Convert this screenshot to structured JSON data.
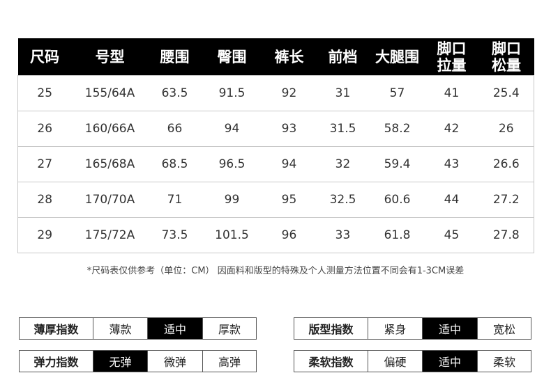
{
  "size_table": {
    "headers": [
      "尺码",
      "号型",
      "腰围",
      "臀围",
      "裤长",
      "前档",
      "大腿围",
      "脚口\n拉量",
      "脚口\n松量"
    ],
    "rows": [
      [
        "25",
        "155/64A",
        "63.5",
        "91.5",
        "92",
        "31",
        "57",
        "41",
        "25.4"
      ],
      [
        "26",
        "160/66A",
        "66",
        "94",
        "93",
        "31.5",
        "58.2",
        "42",
        "26"
      ],
      [
        "27",
        "165/68A",
        "68.5",
        "96.5",
        "94",
        "32",
        "59.4",
        "43",
        "26.6"
      ],
      [
        "28",
        "170/70A",
        "71",
        "99",
        "95",
        "32.5",
        "60.6",
        "44",
        "27.2"
      ],
      [
        "29",
        "175/72A",
        "73.5",
        "101.5",
        "96",
        "33",
        "61.8",
        "45",
        "27.8"
      ]
    ]
  },
  "note": "*尺码表仅供参考（单位：CM） 因面料和版型的特殊及个人测量方法位置不同会有1-3CM误差",
  "indices": [
    {
      "label": "薄厚指数",
      "options": [
        "薄款",
        "适中",
        "厚款"
      ],
      "selected": 1
    },
    {
      "label": "版型指数",
      "options": [
        "紧身",
        "适中",
        "宽松"
      ],
      "selected": 1
    },
    {
      "label": "弹力指数",
      "options": [
        "无弹",
        "微弹",
        "高弹"
      ],
      "selected": 0
    },
    {
      "label": "柔软指数",
      "options": [
        "偏硬",
        "适中",
        "柔软"
      ],
      "selected": 1
    }
  ]
}
